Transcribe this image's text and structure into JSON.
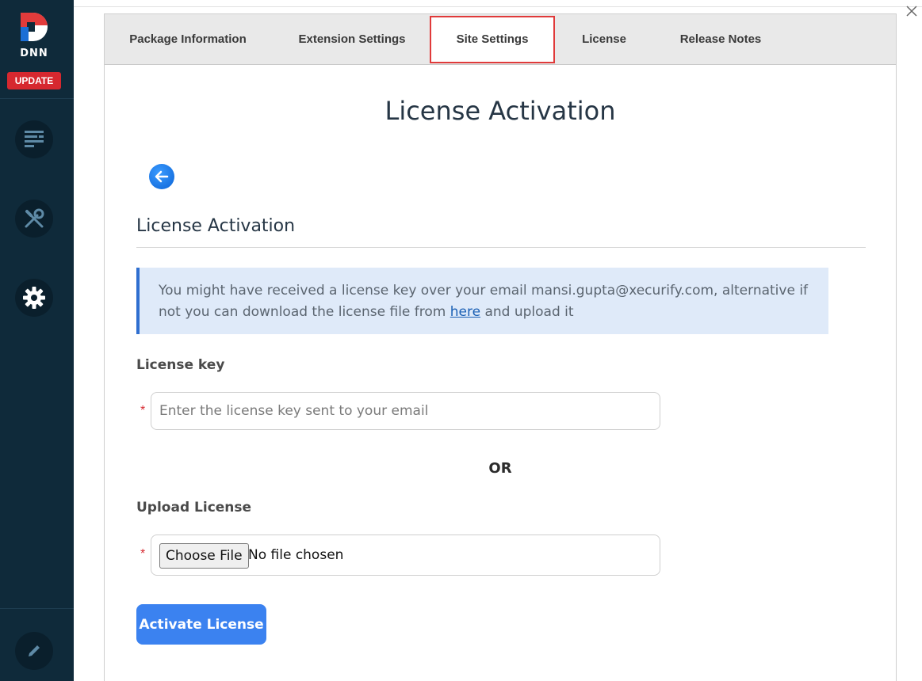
{
  "sidebar": {
    "logo_text": "DNN",
    "update_label": "UPDATE",
    "icons": [
      "content-icon",
      "tools-icon",
      "gear-icon",
      "pencil-icon"
    ]
  },
  "tabs": [
    {
      "label": "Package Information",
      "active": false
    },
    {
      "label": "Extension Settings",
      "active": false
    },
    {
      "label": "Site Settings",
      "active": true
    },
    {
      "label": "License",
      "active": false
    },
    {
      "label": "Release Notes",
      "active": false
    }
  ],
  "page": {
    "title": "License Activation",
    "section_title": "License Activation",
    "info_text_before": "You might have received a license key over your email mansi.gupta@xecurify.com, alternative if not you can download the license file from ",
    "info_link": "here",
    "info_text_after": " and upload it",
    "license_key_label": "License key",
    "license_key_placeholder": "Enter the license key sent to your email",
    "required_mark": "*",
    "or_text": "OR",
    "upload_label": "Upload License",
    "choose_file_label": "Choose File",
    "no_file_text": "No file chosen",
    "activate_label": "Activate License"
  },
  "colors": {
    "sidebar_bg": "#0f2a3a",
    "update_red": "#d6282f",
    "active_tab_border": "#e03a3a",
    "info_bg": "#dfeaf9",
    "info_border": "#2f6fd0",
    "primary_button": "#3b82f0"
  }
}
